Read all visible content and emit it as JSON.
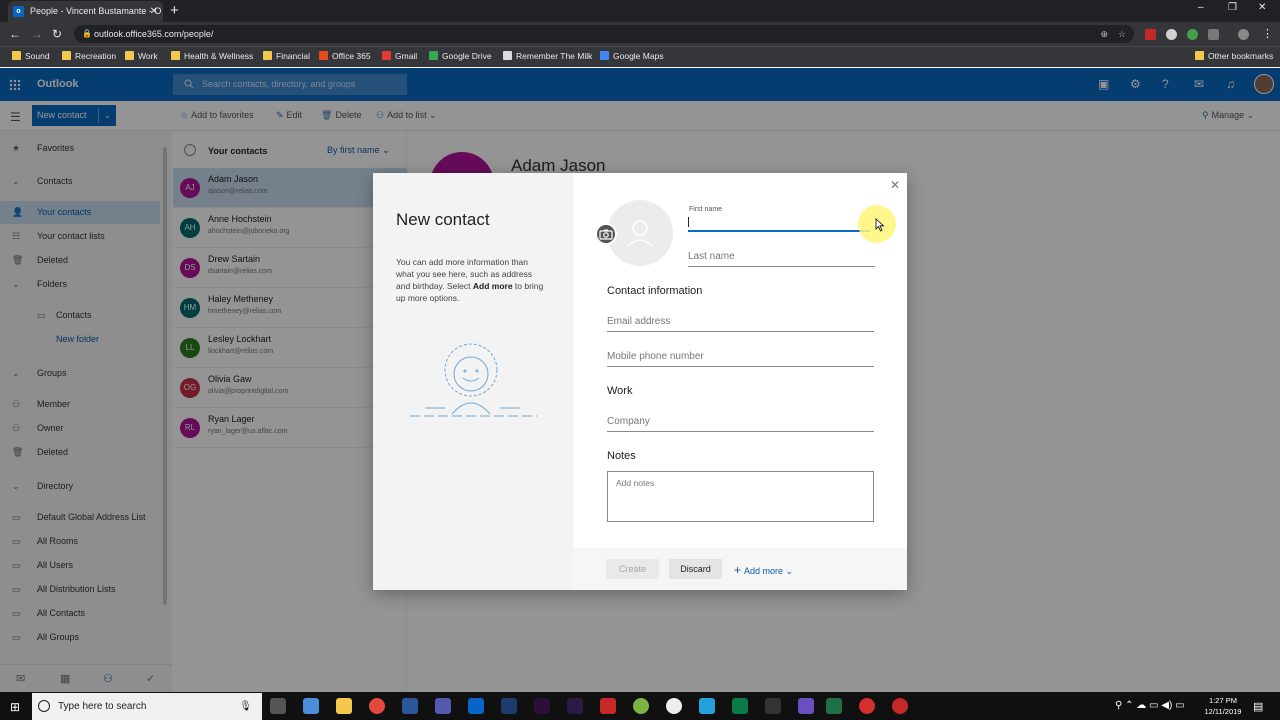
{
  "browser": {
    "tab_title": "People - Vincent Bustamante - O",
    "url": "outlook.office365.com/people/",
    "bookmarks": [
      "Sound",
      "Recreation",
      "Work",
      "Health & Wellness",
      "Financial",
      "Office 365",
      "Gmail",
      "Google Drive",
      "Remember The Milk",
      "Google Maps"
    ],
    "other_bookmarks": "Other bookmarks"
  },
  "app": {
    "brand": "Outlook",
    "search_placeholder": "Search contacts, directory, and groups",
    "new_contact": "New contact",
    "commands": {
      "favorites": "Add to favorites",
      "edit": "Edit",
      "delete": "Delete",
      "add_to_list": "Add to list",
      "manage": "Manage"
    }
  },
  "nav": {
    "favorites": "Favorites",
    "contacts": "Contacts",
    "your_contacts": "Your contacts",
    "contact_lists": "Your contact lists",
    "deleted": "Deleted",
    "folders": "Folders",
    "folder_contacts": "Contacts",
    "new_folder": "New folder",
    "groups": "Groups",
    "member": "Member",
    "owner": "Owner",
    "groups_deleted": "Deleted",
    "directory": "Directory",
    "dir_items": [
      "Default Global Address List",
      "All Rooms",
      "All Users",
      "All Distribution Lists",
      "All Contacts",
      "All Groups"
    ]
  },
  "list": {
    "header": "Your contacts",
    "sort": "By first name",
    "contacts": [
      {
        "initials": "AJ",
        "name": "Adam Jason",
        "email": "ajason@relias.com",
        "color": "#b0149b"
      },
      {
        "initials": "AH",
        "name": "Anne Hochstein",
        "email": "ahochstein@joboneko.org",
        "color": "#036c70"
      },
      {
        "initials": "DS",
        "name": "Drew Sartain",
        "email": "dsartain@relias.com",
        "color": "#b0149b"
      },
      {
        "initials": "HM",
        "name": "Haley Metheney",
        "email": "hmetheney@relias.com",
        "color": "#036c70"
      },
      {
        "initials": "LL",
        "name": "Lesley Lockhart",
        "email": "llockhart@relias.com",
        "color": "#2e7d1e"
      },
      {
        "initials": "OG",
        "name": "Olivia Gaw",
        "email": "olivia@proprintdigital.com",
        "color": "#c4314b"
      },
      {
        "initials": "RL",
        "name": "Ryan Lager",
        "email": "ryan_lager@us.aflac.com",
        "color": "#b0149b"
      }
    ]
  },
  "detail": {
    "name": "Adam Jason"
  },
  "modal": {
    "title": "New contact",
    "desc_pre": "You can add more information than what you see here, such as address and birthday. Select ",
    "desc_bold": "Add more",
    "desc_post": " to bring up more options.",
    "first_name_label": "First name",
    "last_name": "Last name",
    "contact_info": "Contact information",
    "email": "Email address",
    "mobile": "Mobile phone number",
    "work": "Work",
    "company": "Company",
    "notes": "Notes",
    "notes_placeholder": "Add notes",
    "create": "Create",
    "discard": "Discard",
    "add_more": "Add more"
  },
  "taskbar": {
    "search": "Type here to search",
    "time": "1:27 PM",
    "date": "12/11/2019"
  },
  "colors": {
    "brand": "#0b6ac2",
    "selection": "#c9dcf0"
  }
}
